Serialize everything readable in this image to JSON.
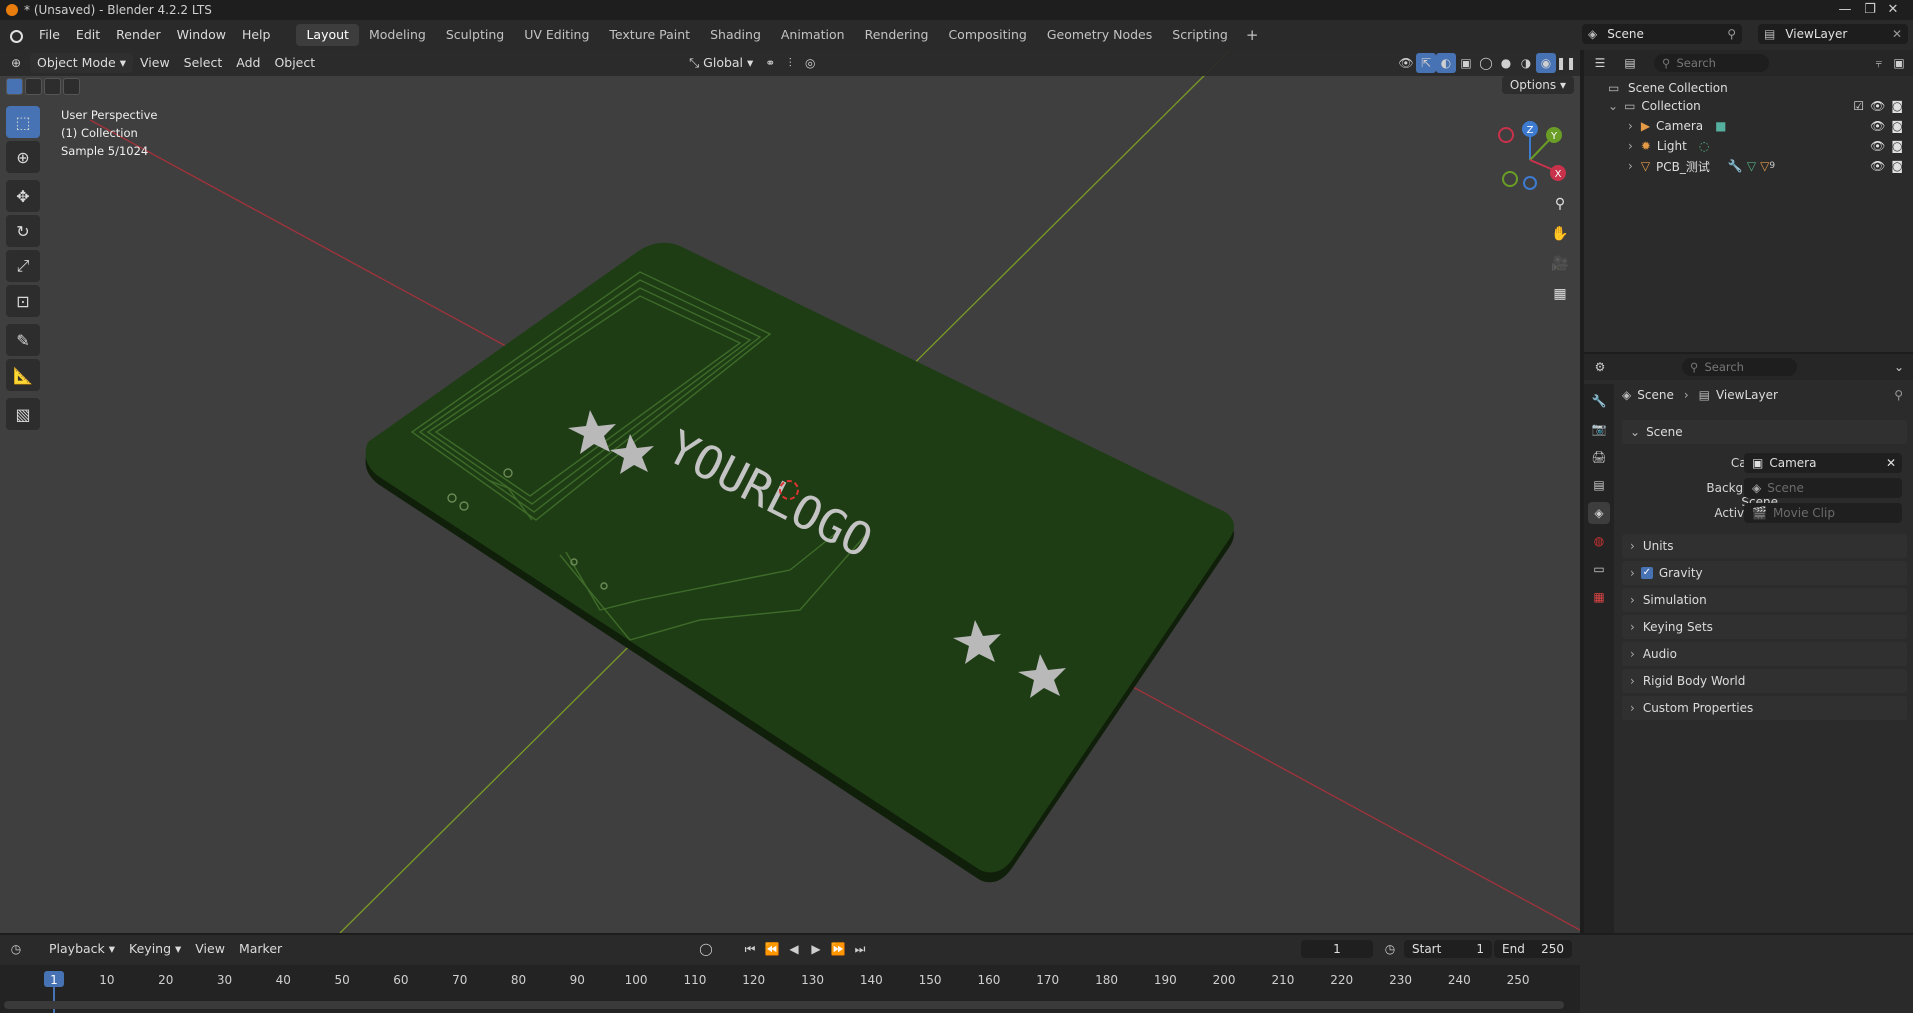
{
  "window": {
    "title": "* (Unsaved) - Blender 4.2.2 LTS",
    "controls": [
      "—",
      "❐",
      "✕"
    ]
  },
  "menus": [
    "File",
    "Edit",
    "Render",
    "Window",
    "Help"
  ],
  "workspaces": [
    {
      "label": "Layout",
      "active": true
    },
    {
      "label": "Modeling"
    },
    {
      "label": "Sculpting"
    },
    {
      "label": "UV Editing"
    },
    {
      "label": "Texture Paint"
    },
    {
      "label": "Shading"
    },
    {
      "label": "Animation"
    },
    {
      "label": "Rendering"
    },
    {
      "label": "Compositing"
    },
    {
      "label": "Geometry Nodes"
    },
    {
      "label": "Scripting"
    }
  ],
  "scene_selector": "Scene",
  "viewlayer_selector": "ViewLayer",
  "viewport": {
    "mode": "Object Mode",
    "menus": [
      "View",
      "Select",
      "Add",
      "Object"
    ],
    "transform_orientation": "Global",
    "options_label": "Options",
    "overlay_lines": [
      "User Perspective",
      "(1) Collection",
      "Sample 5/1024"
    ],
    "logo_text": "YOURLOGO",
    "gizmo_axes": [
      "Z",
      "Y",
      "X"
    ],
    "board_color": "#1e3d14",
    "accent": "#4772b3"
  },
  "outliner": {
    "search_placeholder": "Search",
    "root": "Scene Collection",
    "collection": "Collection",
    "items": [
      {
        "label": "Camera",
        "icon": "camera-icon"
      },
      {
        "label": "Light",
        "icon": "light-icon"
      },
      {
        "label": "PCB_测试",
        "icon": "mesh-icon"
      }
    ],
    "pcb_badge": "9"
  },
  "properties": {
    "search_placeholder": "Search",
    "breadcrumb": [
      "Scene",
      "ViewLayer"
    ],
    "scene_panel": "Scene",
    "fields": [
      {
        "label": "Camera",
        "value": "Camera",
        "empty": false
      },
      {
        "label": "Background Scene",
        "value": "Scene",
        "empty": true
      },
      {
        "label": "Active Clip",
        "value": "Movie Clip",
        "empty": true
      }
    ],
    "sections": [
      "Units",
      "Gravity",
      "Simulation",
      "Keying Sets",
      "Audio",
      "Rigid Body World",
      "Custom Properties"
    ]
  },
  "timeline": {
    "menus": [
      "Playback",
      "Keying",
      "View",
      "Marker"
    ],
    "current_frame": "1",
    "start_label": "Start",
    "start": "1",
    "end_label": "End",
    "end": "250",
    "ticks": [
      "1",
      "10",
      "20",
      "30",
      "40",
      "50",
      "60",
      "70",
      "80",
      "90",
      "100",
      "110",
      "120",
      "130",
      "140",
      "150",
      "160",
      "170",
      "180",
      "190",
      "200",
      "210",
      "220",
      "230",
      "240",
      "250"
    ]
  }
}
